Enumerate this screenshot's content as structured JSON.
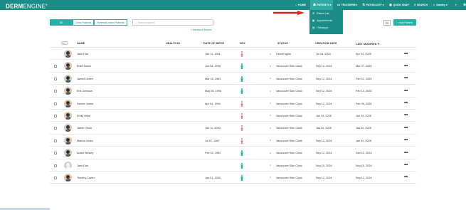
{
  "app": {
    "logo_bold": "DERM",
    "logo_light": "ENGINE",
    "logo_mark": "®"
  },
  "nav": {
    "items": [
      {
        "icon": "⌂",
        "label": "HOME"
      },
      {
        "icon": "☗",
        "label": "PATIENTS ▾"
      },
      {
        "icon": "▭",
        "label": "TELEDERM ▾"
      },
      {
        "icon": "⚗",
        "label": "PATHOLOGY ▾"
      },
      {
        "icon": "◉",
        "label": "QUICK SNAP"
      },
      {
        "icon": "⌕",
        "label": "SEARCH"
      },
      {
        "icon": "◐",
        "label": "Stanley ▾"
      }
    ],
    "dark_mode_icon": "◑",
    "settings_icon": "⚙"
  },
  "patients_menu": [
    {
      "icon": "☰",
      "label": "Patient List"
    },
    {
      "icon": "▦",
      "label": "Appointments"
    },
    {
      "icon": "▤",
      "label": "Followups"
    }
  ],
  "filters": {
    "tabs": [
      "All",
      "Clinic Patients",
      "Referral/Linked Patients"
    ],
    "search_placeholder": "Search patient",
    "advanced_search": "+ Advanced Search",
    "filter_icon": "⊞",
    "add_patient": "+ Add Patient"
  },
  "table": {
    "headers": {
      "health_id": "HEALTH ID",
      "name": "NAME",
      "dob": "DATE OF BIRTH",
      "sex": "SEX",
      "status": "STATUS",
      "creation_date": "CREATION DATE",
      "last_modified": "LAST MODIFIED ▾"
    },
    "rows": [
      {
        "name": "Jane Doe",
        "dob": "Jan 11, 1981",
        "sex": "F",
        "status": "DermEngine",
        "created": "Jul 18, 2024",
        "modified": "Apr 04, 2025",
        "checkbox": false,
        "avatar": true
      },
      {
        "name": "Brian David",
        "dob": "Jun 06, 1996",
        "sex": "M",
        "status": "Vancouver Skin Clinic",
        "created": "Sep 12, 2024",
        "modified": "Mar 07, 2025",
        "checkbox": true,
        "avatar": true
      },
      {
        "name": "James Green",
        "dob": "Mar 03, 1993",
        "sex": "M",
        "status": "Vancouver Skin Clinic",
        "created": "Sep 12, 2024",
        "modified": "Feb 21, 2025",
        "checkbox": true,
        "avatar": true
      },
      {
        "name": "Erik Johnson",
        "dob": "May 05, 1995",
        "sex": "M",
        "status": "Vancouver Skin Clinic",
        "created": "Sep 12, 2024",
        "modified": "Feb 14, 2025",
        "checkbox": true,
        "avatar": true
      },
      {
        "name": "Sammi Jones",
        "dob": "Apr 04, 1994",
        "sex": "F",
        "status": "Vancouver Skin Clinic",
        "created": "Sep 12, 2024",
        "modified": "Feb 06, 2025",
        "checkbox": true,
        "avatar": true
      },
      {
        "name": "Emily West",
        "dob": "",
        "sex": "F",
        "status": "Vancouver Skin Clinic",
        "created": "Jan 29, 2025",
        "modified": "Jan 29, 2025",
        "checkbox": true,
        "avatar": true
      },
      {
        "name": "Jamie Olson",
        "dob": "Jan 11, 2000",
        "sex": "F",
        "status": "Vancouver Skin Clinic",
        "created": "Jan 02, 2025",
        "modified": "Jan 02, 2025",
        "checkbox": true,
        "avatar": true
      },
      {
        "name": "Marina Jones",
        "dob": "Jul 07, 1987",
        "sex": "F",
        "status": "Vancouver Skin Clinic",
        "created": "Sep 12, 2024",
        "modified": "Jan 02, 2025",
        "checkbox": true,
        "avatar": true
      },
      {
        "name": "Adam Wesley",
        "dob": "Feb 02, 1992",
        "sex": "M",
        "status": "Vancouver Skin Clinic",
        "created": "Sep 12, 2024",
        "modified": "Dec 13, 2024",
        "checkbox": true,
        "avatar": true
      },
      {
        "name": "Jane Doe",
        "dob": "",
        "sex": "M",
        "status": "Vancouver Skin Clinic",
        "created": "Nov 15, 2024",
        "modified": "Nov 15, 2024",
        "checkbox": true,
        "avatar": false
      },
      {
        "name": "Timothy Carter",
        "dob": "Jan 01, 2000",
        "sex": "M",
        "status": "Vancouver Skin Clinic",
        "created": "Sep 12, 2024",
        "modified": "Sep 12, 2024",
        "checkbox": true,
        "avatar": true
      }
    ],
    "female_color": "#e8736f",
    "male_color": "#1fb5a7",
    "more_icon": "•••",
    "clinic_icon": "⌂"
  }
}
